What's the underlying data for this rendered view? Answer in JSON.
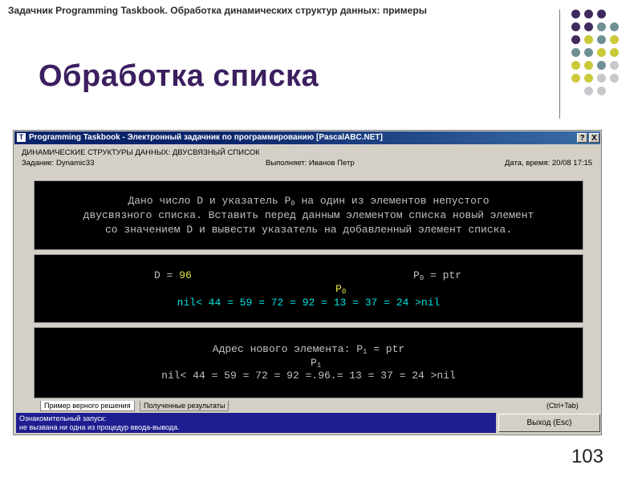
{
  "slide": {
    "header": "Задачник Programming Taskbook. Обработка динамических структур данных: примеры",
    "title": "Обработка списка",
    "page_number": "103"
  },
  "colors": {
    "title": "#3b1f5f",
    "dot_purple": "#3f2a5e",
    "dot_teal": "#6e8f93",
    "dot_olive": "#c9c93a",
    "dot_gray": "#c8c8cc",
    "titlebar": "#0a246a",
    "status_bg": "#1e1e90"
  },
  "window": {
    "title": "Programming Taskbook - Электронный задачник по программированию [PascalABC.NET]",
    "app_icon": "T",
    "help_button": "?",
    "close_button": "X"
  },
  "task": {
    "section": "ДИНАМИЧЕСКИЕ СТРУКТУРЫ ДАННЫХ: ДВУСВЯЗНЫЙ СПИСОК",
    "task_label": "Задание: Dynamic33",
    "executor_label": "Выполняет: Иванов Петр",
    "datetime_label": "Дата, время: 20/08 17:15"
  },
  "description": {
    "line1_a": "Дано число D и указатель P",
    "line1_sub": "0",
    "line1_b": " на один из элементов непустого",
    "line2": "двусвязного списка. Вставить перед данным элементом списка новый элемент",
    "line3": "со значением D и вывести указатель на добавленный элемент списка."
  },
  "input_panel": {
    "d_label": "D = ",
    "d_value": "96",
    "p0_label": "P",
    "p0_sub": "0",
    "p0_eq": " = ptr",
    "pointer_label": "P",
    "pointer_sub": "0",
    "list_text": "nil< 44 = 59 = 72 = 92 = 13 = 37 = 24 >nil"
  },
  "result_panel": {
    "label_a": "Адрес нового элемента: P",
    "label_sub": "1",
    "label_b": " = ptr",
    "pointer_label": "P",
    "pointer_sub": "1",
    "list_text": "nil< 44 = 59 = 72 = 92 =.96.= 13 = 37 = 24 >nil"
  },
  "tabs": [
    {
      "label": "Пример верного решения"
    },
    {
      "label": "Полученные результаты"
    }
  ],
  "hotkey_hint": "(Ctrl+Tab)",
  "status": {
    "line1": "Ознакомительный запуск:",
    "line2": "не вызвана ни одна из процедур ввода-вывода."
  },
  "exit_button": "Выход (Esc)"
}
